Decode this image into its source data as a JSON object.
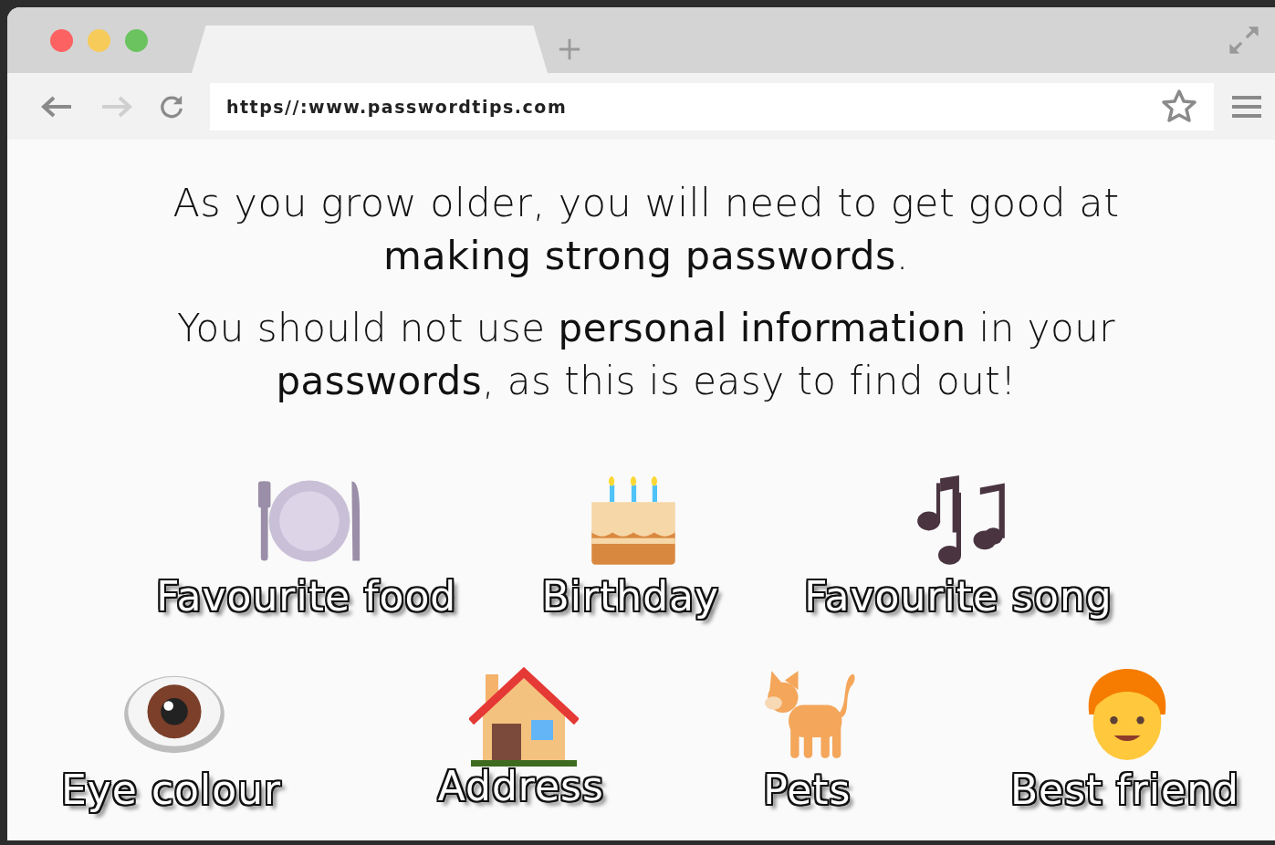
{
  "browser": {
    "url": "https//:www.passwordtips.com",
    "bookmarked": false
  },
  "paragraphs": [
    "As you grow older, you will need to get good at **making strong passwords**.",
    "You should not use **personal information** in your **passwords**, as this is easy to find out!"
  ],
  "rows": [
    [
      {
        "kind": "food",
        "label": "Favourite food"
      },
      {
        "kind": "cake",
        "label": "Birthday"
      },
      {
        "kind": "music",
        "label": "Favourite song"
      }
    ],
    [
      {
        "kind": "eye",
        "label": "Eye colour"
      },
      {
        "kind": "house",
        "label": "Address"
      },
      {
        "kind": "cat",
        "label": "Pets"
      },
      {
        "kind": "person",
        "label": "Best friend"
      }
    ]
  ]
}
